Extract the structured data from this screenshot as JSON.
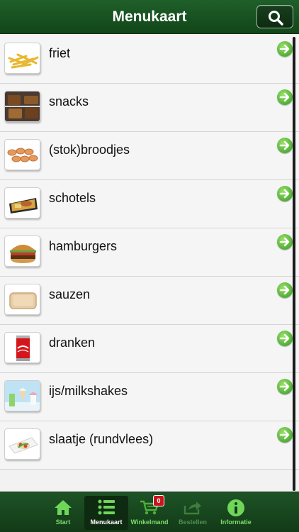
{
  "header": {
    "title": "Menukaart"
  },
  "menu": [
    {
      "label": "friet",
      "icon": "fries-icon"
    },
    {
      "label": "snacks",
      "icon": "snacks-icon"
    },
    {
      "label": "(stok)broodjes",
      "icon": "rolls-icon"
    },
    {
      "label": "schotels",
      "icon": "platter-icon"
    },
    {
      "label": "hamburgers",
      "icon": "hamburger-icon"
    },
    {
      "label": "sauzen",
      "icon": "sauce-icon"
    },
    {
      "label": "dranken",
      "icon": "cola-can-icon"
    },
    {
      "label": "ijs/milkshakes",
      "icon": "ice-cream-icon"
    },
    {
      "label": "slaatje (rundvlees)",
      "icon": "salad-icon"
    }
  ],
  "tabbar": {
    "tabs": [
      {
        "label": "Start",
        "icon": "home-icon",
        "state": "normal"
      },
      {
        "label": "Menukaart",
        "icon": "list-icon",
        "state": "active"
      },
      {
        "label": "Winkelmand",
        "icon": "cart-icon",
        "state": "normal",
        "badge": "0"
      },
      {
        "label": "Bestellen",
        "icon": "share-icon",
        "state": "disabled"
      },
      {
        "label": "Informatie",
        "icon": "info-icon",
        "state": "normal"
      }
    ]
  },
  "colors": {
    "brand_green": "#1a4f22",
    "accent_green": "#7ddc6a",
    "badge_red": "#c8141b"
  }
}
